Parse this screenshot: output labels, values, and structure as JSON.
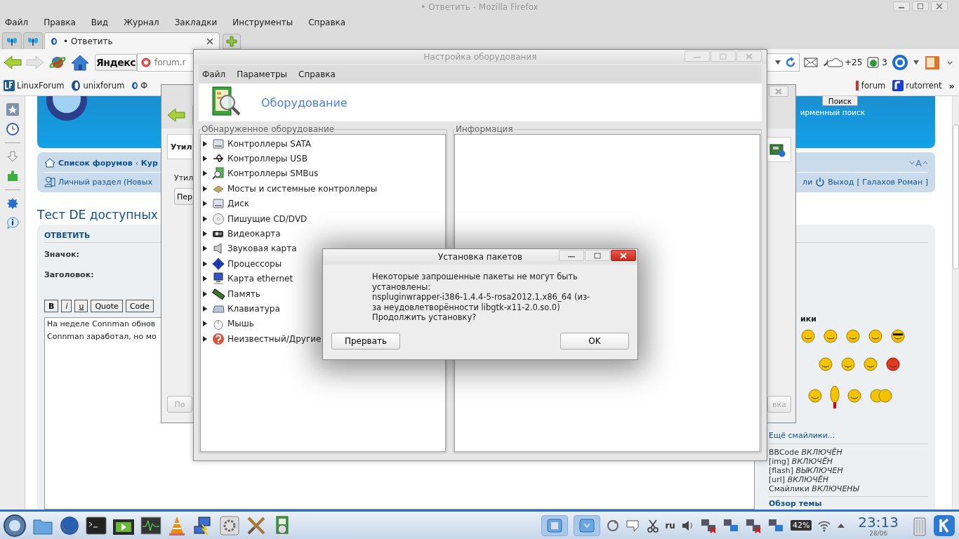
{
  "browser": {
    "title": "• Ответить - Mozilla Firefox",
    "menu": [
      "Файл",
      "Правка",
      "Вид",
      "Журнал",
      "Закладки",
      "Инструменты",
      "Справка"
    ],
    "tabs": [
      {
        "kind": "pinned",
        "selected": false
      },
      {
        "kind": "pinned",
        "selected": false
      },
      {
        "kind": "page",
        "label": "• Ответить",
        "selected": true
      }
    ],
    "search_engine": "Яндекс",
    "url": "forum.r",
    "weather": "+25",
    "counter": "3",
    "bookmarks": [
      "LinuxForum",
      "unixforum",
      "Ф"
    ],
    "bookmarks_right": [
      "forum",
      "rutorrent"
    ],
    "bookmarks_overflow": "»"
  },
  "forum": {
    "search_button": "Поиск",
    "advanced_search": "ирменный поиск",
    "breadcrumb": [
      "Список форумов",
      "Кур"
    ],
    "breadcrumb_separator": "‹",
    "font_size": "A",
    "user_panel": "Личный раздел (Новых",
    "members": "ли",
    "logout": "Выход",
    "user": "[ Галахов Роман ]",
    "topic_title": "Тест DE доступных",
    "form_title": "ОТВЕТИТЬ",
    "labels": [
      "Значок:",
      "Заголовок:"
    ],
    "format_buttons": [
      "B",
      "i",
      "u",
      "Quote",
      "Code"
    ],
    "message_lines": [
      "На неделе Connman обнов",
      "Connman заработал, но мо"
    ],
    "smilies_title": "ики",
    "more_smilies": "Ещё смайлики...",
    "options": [
      "BBCode *ВКЛЮЧЁН*",
      "[img] *ВКЛЮЧЁН*",
      "[flash] *ВЫКЛЮЧЕН*",
      "[url] *ВКЛЮЧЁН*",
      "Смайлики *ВКЛЮЧЕНЫ*"
    ],
    "topic_review": "Обзор темы"
  },
  "back_dialog": {
    "header_field": "Утил",
    "label": "Утил",
    "button": "Пер",
    "bottom_left_button": "По",
    "bottom_right_button": "вка"
  },
  "hardware": {
    "title": "Настройка оборудования",
    "menu": [
      "Файл",
      "Параметры",
      "Справка"
    ],
    "heading": "Оборудование",
    "tree_title": "Обнаруженное оборудование",
    "info_title": "Информация",
    "devices": [
      {
        "label": "Контроллеры SATA",
        "expanded": false
      },
      {
        "label": "Контроллеры USB",
        "expanded": false
      },
      {
        "label": "Контроллеры SMBus",
        "expanded": false
      },
      {
        "label": "Мосты и системные контроллеры",
        "expanded": false
      },
      {
        "label": "Диск",
        "expanded": false
      },
      {
        "label": "Пишущие CD/DVD",
        "expanded": false
      },
      {
        "label": "Видеокарта",
        "expanded": false
      },
      {
        "label": "Звуковая карта",
        "expanded": false
      },
      {
        "label": "Процессоры",
        "expanded": false
      },
      {
        "label": "Карта ethernet",
        "expanded": false
      },
      {
        "label": "Память",
        "expanded": false
      },
      {
        "label": "Клавиатура",
        "expanded": false
      },
      {
        "label": "Мышь",
        "expanded": false
      },
      {
        "label": "Неизвестный/Другие",
        "expanded": false
      }
    ]
  },
  "package_dialog": {
    "title": "Установка пакетов",
    "message_lines": [
      "Некоторые запрошенные пакеты не могут быть",
      "установлены:",
      "nspluginwrapper-i386-1.4.4-5-rosa2012.1.x86_64 (из-",
      "за неудовлетворённости libgtk-x11-2.0.so.0)",
      "Продолжить установку?"
    ],
    "buttons": [
      "Прервать",
      "OK"
    ]
  },
  "taskbar": {
    "layout": "ru",
    "battery": "42%",
    "time": "23:13",
    "date": "28/06"
  }
}
